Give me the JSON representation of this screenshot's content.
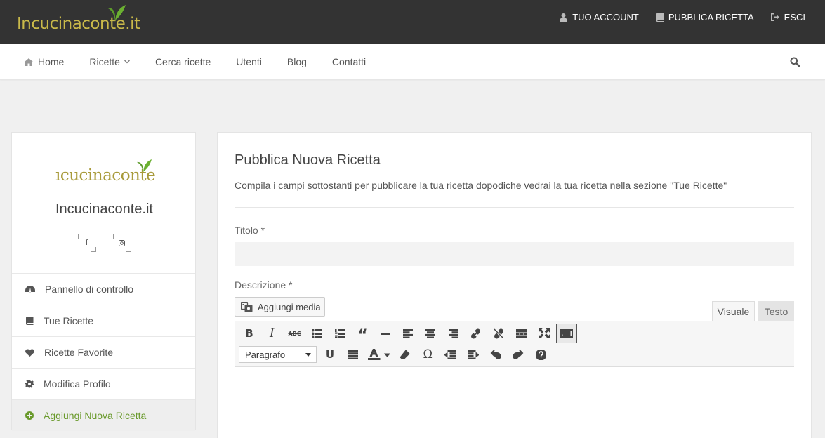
{
  "header": {
    "logo_text": "Incucinaconte.it",
    "links": [
      {
        "label": "TUO ACCOUNT",
        "icon": "user-icon"
      },
      {
        "label": "PUBBLICA RICETTA",
        "icon": "book-icon"
      },
      {
        "label": "ESCI",
        "icon": "sign-out-icon"
      }
    ]
  },
  "nav": {
    "items": [
      {
        "label": "Home",
        "icon": "home-icon"
      },
      {
        "label": "Ricette",
        "icon": "chevron-down-icon"
      },
      {
        "label": "Cerca ricette"
      },
      {
        "label": "Utenti"
      },
      {
        "label": "Blog"
      },
      {
        "label": "Contatti"
      }
    ],
    "search_icon": "search-icon"
  },
  "sidebar": {
    "logo_text": "ıcucinaconte",
    "site_name": "Incucinaconte.it",
    "social": [
      "f",
      "instagram-icon"
    ],
    "menu": [
      {
        "label": "Pannello di controllo",
        "icon": "dashboard-icon"
      },
      {
        "label": "Tue Ricette",
        "icon": "book-icon"
      },
      {
        "label": "Ricette Favorite",
        "icon": "heart-icon"
      },
      {
        "label": "Modifica Profilo",
        "icon": "gear-icon"
      },
      {
        "label": "Aggiungi Nuova Ricetta",
        "icon": "plus-circle-icon",
        "active": true
      }
    ]
  },
  "form": {
    "title": "Pubblica Nuova Ricetta",
    "description": "Compila i campi sottostanti per pubblicare la tua ricetta dopodiche vedrai la tua ricetta nella sezione \"Tue Ricette\"",
    "titolo_label": "Titolo *",
    "titolo_value": "",
    "descrizione_label": "Descrizione *",
    "media_button": "Aggiungi media",
    "tabs": [
      "Visuale",
      "Testo"
    ],
    "format_select": "Paragrafo"
  },
  "colors": {
    "topbar": "#333333",
    "accent_green": "#6a9a2c",
    "logo_gold": "#c9b94a"
  }
}
